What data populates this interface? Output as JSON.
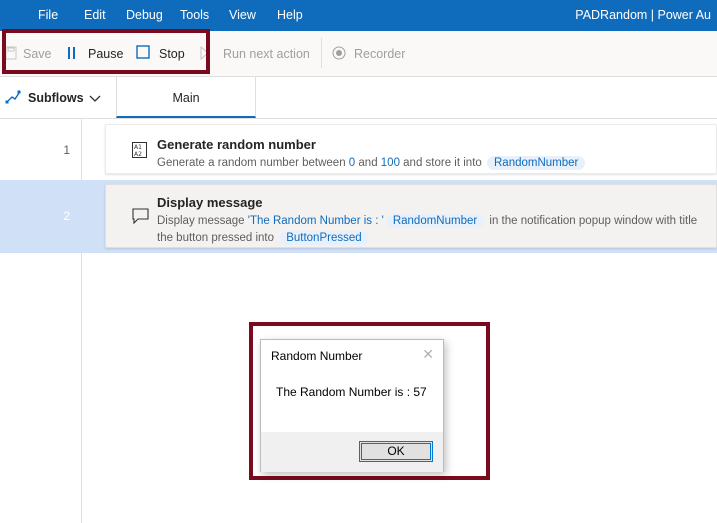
{
  "menubar": {
    "items": [
      "File",
      "Edit",
      "Debug",
      "Tools",
      "View",
      "Help"
    ],
    "app_title": "PADRandom | Power Au",
    "bg_color": "#0f6cbd"
  },
  "toolbar": {
    "save_label": "Save",
    "pause_label": "Pause",
    "stop_label": "Stop",
    "run_next_label": "Run next action",
    "recorder_label": "Recorder"
  },
  "tabs": {
    "subflows_label": "Subflows",
    "main_label": "Main"
  },
  "actions": [
    {
      "line": "1",
      "icon": "random-number-icon",
      "title": "Generate random number",
      "desc_parts": {
        "p1": "Generate a random number between ",
        "min": "0",
        "p2": " and ",
        "max": "100",
        "p3": " and store it into ",
        "var": "RandomNumber"
      }
    },
    {
      "line": "2",
      "icon": "message-icon",
      "title": "Display message",
      "desc_parts": {
        "p1": "Display message ",
        "str": "'The Random Number is : '",
        "var": "RandomNumber",
        "p2": " in the notification popup window with title",
        "p3": "the button pressed into ",
        "var2": "ButtonPressed"
      }
    }
  ],
  "dialog": {
    "title": "Random Number",
    "close_glyph": "✕",
    "message": "The Random Number is : 57",
    "ok_label": "OK"
  },
  "colors": {
    "highlight_border": "#7a0a1d",
    "selected_row": "#cfe0f7",
    "accent": "#0f6cbd"
  }
}
